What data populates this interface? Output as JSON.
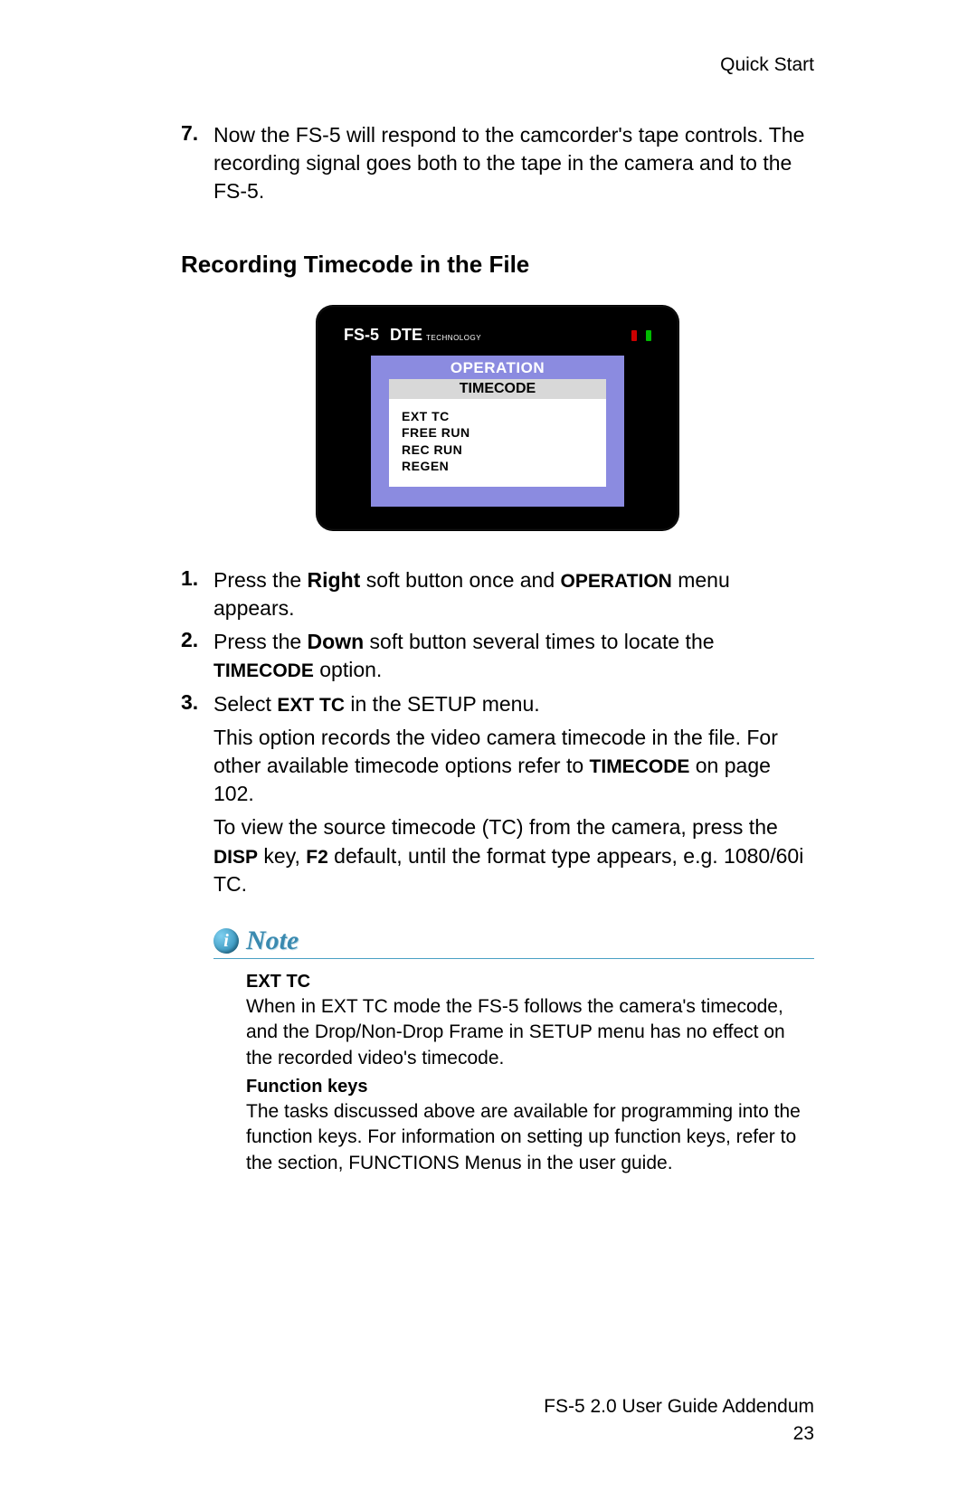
{
  "header": {
    "right": "Quick Start"
  },
  "intro": {
    "num": "7.",
    "text": "Now the FS-5 will respond to the camcorder's tape controls. The recording signal goes both to the tape in the camera and to the FS-5."
  },
  "section_heading": "Recording Timecode in the File",
  "device": {
    "brand": "FS-5",
    "dte": "DTE",
    "dte_sub": "TECHNOLOGY",
    "screen_header": "OPERATION",
    "screen_sub": "TIMECODE",
    "options": [
      "EXT TC",
      "FREE RUN",
      "REC RUN",
      "REGEN"
    ]
  },
  "steps": [
    {
      "num": "1.",
      "pre": "Press the ",
      "b1": "Right",
      "mid": " soft button once and ",
      "sc1": "OPERATION",
      "post": " menu appears."
    },
    {
      "num": "2.",
      "pre": "Press the ",
      "b1": "Down",
      "mid": " soft button several times to locate the ",
      "sc1": "TIMECODE",
      "post": " option."
    },
    {
      "num": "3.",
      "pre": "Select ",
      "sc0": "EXT TC",
      "post": " in the SETUP menu."
    }
  ],
  "cont1": {
    "pre": "This option records the video camera timecode in the file. For other available timecode options refer to ",
    "sc": "TIMECODE",
    "post": " on page 102."
  },
  "cont2": {
    "pre": "To view the source timecode (TC) from the camera, press the ",
    "sc1": "DISP",
    "mid1": " key, ",
    "sc2": "F2",
    "post": " default, until the format type appears, e.g. 1080/60i TC."
  },
  "note": {
    "label": "Note",
    "h1": "EXT TC",
    "p1": "When in EXT TC mode the FS-5 follows the camera's timecode, and the Drop/Non-Drop Frame in SETUP menu has no effect on the recorded video's timecode.",
    "h2": "Function keys",
    "p2": "The tasks discussed above are available for programming into the function keys. For information on setting up function keys, refer to the section, FUNCTIONS Menus in the user guide."
  },
  "footer": {
    "doc": "FS-5 2.0 User Guide Addendum",
    "page": "23"
  }
}
